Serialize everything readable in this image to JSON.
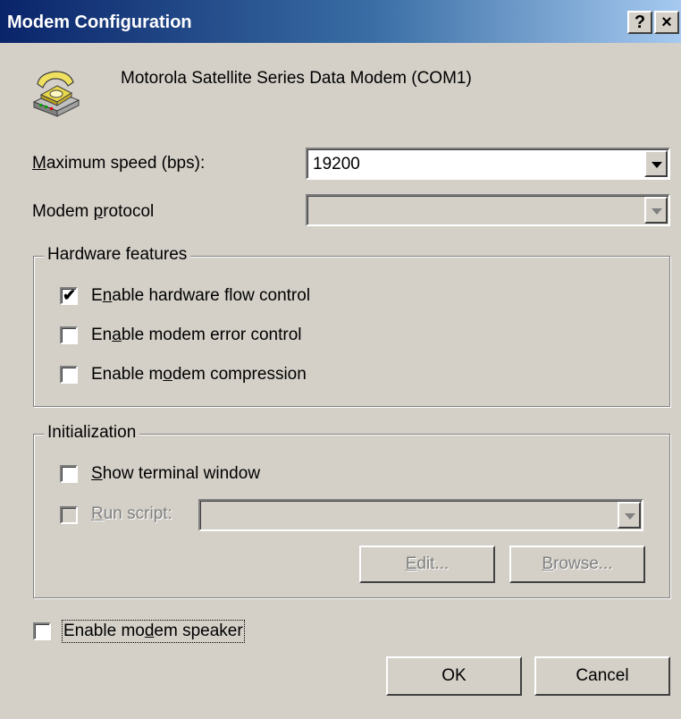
{
  "window": {
    "title": "Modem Configuration",
    "help_label": "?",
    "close_label": "×"
  },
  "header": {
    "icon": "telephone-modem-icon",
    "device_name": "Motorola Satellite Series Data Modem (COM1)"
  },
  "fields": {
    "max_speed": {
      "label_prefix": "",
      "label_hotkey": "M",
      "label_rest": "aximum speed (bps):",
      "value": "19200"
    },
    "protocol": {
      "label_prefix": "Modem ",
      "label_hotkey": "p",
      "label_rest": "rotocol",
      "value": ""
    }
  },
  "hardware": {
    "legend": "Hardware features",
    "options": [
      {
        "pre": "E",
        "hotkey": "n",
        "post": "able hardware flow control",
        "checked": true
      },
      {
        "pre": "En",
        "hotkey": "a",
        "post": "ble modem error control",
        "checked": false
      },
      {
        "pre": "Enable m",
        "hotkey": "o",
        "post": "dem compression",
        "checked": false
      }
    ]
  },
  "initialization": {
    "legend": "Initialization",
    "show_terminal": {
      "pre": "",
      "hotkey": "S",
      "post": "how terminal window",
      "checked": false
    },
    "run_script": {
      "pre": "",
      "hotkey": "R",
      "post": "un script:",
      "checked": false,
      "enabled": false,
      "value": ""
    },
    "edit_button": {
      "pre": "",
      "hotkey": "E",
      "post": "dit..."
    },
    "browse_button": {
      "pre": "",
      "hotkey": "B",
      "post": "rowse..."
    }
  },
  "speaker": {
    "pre": "Enable mo",
    "hotkey": "d",
    "post": "em speaker",
    "checked": false
  },
  "buttons": {
    "ok": "OK",
    "cancel": "Cancel"
  },
  "colors": {
    "face": "#d4d0c8",
    "title_start": "#0a246a",
    "title_end": "#a6caf0",
    "disabled_text": "#808080"
  }
}
